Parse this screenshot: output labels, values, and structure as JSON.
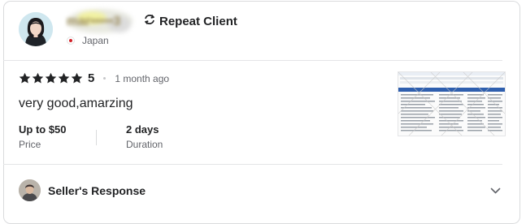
{
  "reviewer": {
    "name_masked": "mar•••••3",
    "badge_label": "Repeat Client",
    "badge_icon": "repeat-icon",
    "country": "Japan",
    "flag_icon": "japan-flag-icon"
  },
  "review": {
    "rating_stars": 5,
    "rating_value": "5",
    "time_ago": "1 month ago",
    "text": "very good,amarzing",
    "stats": [
      {
        "value": "Up to $50",
        "label": "Price"
      },
      {
        "value": "2 days",
        "label": "Duration"
      }
    ]
  },
  "seller_response": {
    "label": "Seller's Response",
    "toggle_icon": "chevron-down-icon"
  },
  "colors": {
    "star": "#222325",
    "text_secondary": "#62646a",
    "border": "#dadbdd"
  }
}
